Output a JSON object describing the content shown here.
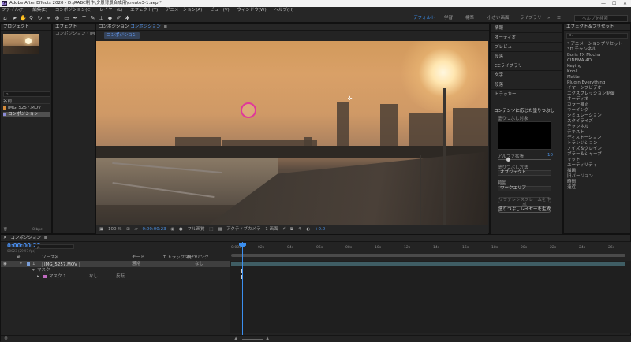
{
  "window": {
    "title": "Adobe After Effects 2020 - D:\\RABC制作\\夕景背景合成用\\create3-1.aep *"
  },
  "menu": [
    "ファイル(F)",
    "編集(E)",
    "コンポジション(C)",
    "レイヤー(L)",
    "エフェクト(T)",
    "アニメーション(A)",
    "ビュー(V)",
    "ウィンドウ(W)",
    "ヘルプ(H)"
  ],
  "workspaces": [
    "デフォルト",
    "学習",
    "標準",
    "小さい画面",
    "ライブラリ"
  ],
  "help_search_placeholder": "ヘルプを検索",
  "project": {
    "title": "プロジェクト",
    "search_placeholder": "ρ.",
    "col_name": "名前",
    "items": [
      {
        "name": "IMG_5257.MOV",
        "kind": "footage"
      },
      {
        "name": "コンポジション",
        "kind": "composition",
        "selected": true
      }
    ],
    "bit_depth": "8 bpc"
  },
  "effect_controls": {
    "title": "エフェクト",
    "subtitle": "コンポジション・IMG_52"
  },
  "comp_panel": {
    "title_prefix": "コンポジション",
    "title_name": "コンポジション",
    "tab": "コンポジション",
    "zoom": "100 %",
    "timecode": "0:00:00:23",
    "resolution": "フル画質",
    "camera": "アクティブカメラ",
    "views": "1 画面",
    "exposure": "+0.0"
  },
  "right_panels": [
    "情報",
    "オーディオ",
    "プレビュー",
    "段落",
    "CCライブラリ",
    "文字",
    "段落",
    "トラッカー"
  ],
  "content_aware_fill": {
    "title": "コンテンツに応じた塗りつぶし",
    "fill_target_label": "塗りつぶし対象",
    "alpha_expand_label": "アルファ拡張",
    "alpha_expand_value": "10",
    "fill_method_label": "塗りつぶし方法",
    "fill_method_value": "オブジェクト",
    "range_label": "範囲",
    "range_value": "ワークエリア",
    "ref_button": "リファレンスフレームを作成",
    "generate_button": "塗りつぶしレイヤーを生成"
  },
  "effects_presets": {
    "title": "エフェクト＆プリセット",
    "search_placeholder": "ρ.",
    "items": [
      "* アニメーションプリセット",
      "3D チャンネル",
      "Boris FX Mocha",
      "CINEMA 4D",
      "Keying",
      "Knoll",
      "Matte",
      "Plugin Everything",
      "イマーシブビデオ",
      "エクスプレッション制御",
      "オーディオ",
      "カラー補正",
      "キーイング",
      "シミュレーション",
      "スタイライズ",
      "チャンネル",
      "テキスト",
      "ディストーション",
      "トランジション",
      "ノイズ＆グレイン",
      "ブラー＆シャープ",
      "マット",
      "ユーティリティ",
      "描画",
      "旧バージョン",
      "時間",
      "遠近"
    ]
  },
  "timeline": {
    "tab": "コンポジション",
    "timecode": "0:00:00:23",
    "fps": "00023 (29.97 fps)",
    "search_placeholder": "ρ.",
    "cols": {
      "num": "#",
      "source": "ソース名",
      "mode": "モード",
      "trkmat": "T トラックマット",
      "parent": "親とリンク"
    },
    "layers": [
      {
        "num": "1",
        "name": "IMG_5257.MOV",
        "mode": "通常",
        "parent": "なし"
      }
    ],
    "mask_group": "マスク",
    "mask": {
      "name": "マスク 1",
      "mode": "なし",
      "inverted": "反転"
    },
    "ruler": [
      "0:00s",
      "02s",
      "04s",
      "06s",
      "08s",
      "10s",
      "12s",
      "14s",
      "16s",
      "18s",
      "20s",
      "22s",
      "24s",
      "26s"
    ],
    "footer": "フレームレンダリング時間 0ミリ秒"
  },
  "colors": {
    "accent": "#3b8ff0",
    "mask": "#e0389a",
    "track": "#3f5d64"
  }
}
